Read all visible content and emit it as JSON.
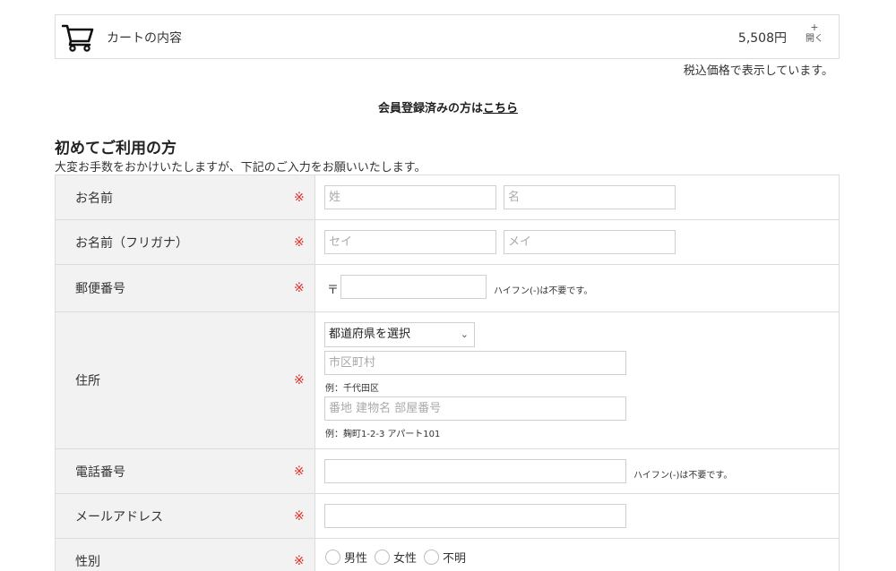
{
  "cart": {
    "label": "カートの内容",
    "total": "5,508円",
    "toggle_plus": "+",
    "toggle_open": "開く",
    "tax_note": "税込価格で表示しています。"
  },
  "member": {
    "prefix": "会員登録済みの方は",
    "link": "こちら"
  },
  "section": {
    "title": "初めてご利用の方",
    "desc": "大変お手数をおかけいたしますが、下記のご入力をお願いいたします。"
  },
  "required_mark": "※",
  "form": {
    "name": {
      "label": "お名前",
      "last_placeholder": "姓",
      "first_placeholder": "名"
    },
    "kana": {
      "label": "お名前（フリガナ）",
      "last_placeholder": "セイ",
      "first_placeholder": "メイ"
    },
    "postal": {
      "label": "郵便番号",
      "mark": "〒",
      "hint": "ハイフン(-)は不要です。"
    },
    "address": {
      "label": "住所",
      "prefecture_select": "都道府県を選択",
      "city_placeholder": "市区町村",
      "city_hint": "例：千代田区",
      "street_placeholder": "番地 建物名 部屋番号",
      "street_hint": "例：麹町1-2-3 アパート101"
    },
    "phone": {
      "label": "電話番号",
      "hint": "ハイフン(-)は不要です。"
    },
    "email": {
      "label": "メールアドレス"
    },
    "gender": {
      "label": "性別",
      "options": [
        "男性",
        "女性",
        "不明"
      ]
    }
  }
}
